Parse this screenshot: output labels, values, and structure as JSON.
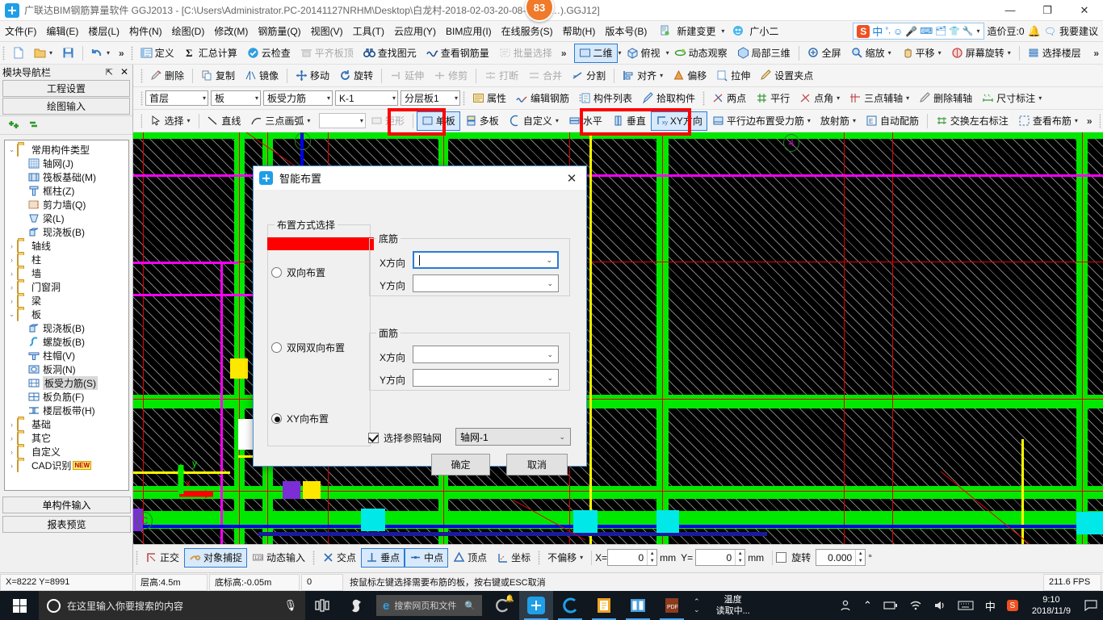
{
  "window": {
    "title": "广联达BIM钢筋算量软件 GGJ2013 - [C:\\Users\\Administrator.PC-20141127NRHM\\Desktop\\白龙村-2018-02-03-20-08-17(26…).GGJ12]",
    "badge": "83",
    "minimize": "—",
    "maximize": "❐",
    "close": "✕"
  },
  "menu": {
    "items": [
      {
        "label": "文件(F)"
      },
      {
        "label": "编辑(E)"
      },
      {
        "label": "楼层(L)"
      },
      {
        "label": "构件(N)"
      },
      {
        "label": "绘图(D)"
      },
      {
        "label": "修改(M)"
      },
      {
        "label": "钢筋量(Q)"
      },
      {
        "label": "视图(V)"
      },
      {
        "label": "工具(T)"
      },
      {
        "label": "云应用(Y)"
      },
      {
        "label": "BIM应用(I)"
      },
      {
        "label": "在线服务(S)"
      },
      {
        "label": "帮助(H)"
      },
      {
        "label": "版本号(B)"
      }
    ],
    "new_change": "新建变更",
    "assistant": "广小二",
    "ime_zh": "中",
    "coins_label": "造价豆:0",
    "suggestion": "我要建议"
  },
  "toolbar_row1": {
    "left_icons": [
      "new-file",
      "open-file",
      "save-file",
      "undo"
    ],
    "overflow": "»",
    "items": [
      {
        "label": "定义",
        "icon": "define-icon",
        "disabled": false
      },
      {
        "label": "汇总计算",
        "icon": "sigma-icon",
        "disabled": false
      },
      {
        "label": "云检查",
        "icon": "cloud-check-icon",
        "disabled": false
      },
      {
        "label": "平齐板顶",
        "icon": "align-slab-icon",
        "disabled": true
      },
      {
        "label": "查找图元",
        "icon": "binoculars-icon",
        "disabled": false
      },
      {
        "label": "查看钢筋量",
        "icon": "rebar-view-icon",
        "disabled": false
      },
      {
        "label": "批量选择",
        "icon": "batch-select-icon",
        "disabled": true
      }
    ],
    "view_items": [
      {
        "label": "二维",
        "icon": "2d-icon",
        "dropdown": true,
        "selected": true
      },
      {
        "label": "俯视",
        "icon": "top-view-icon",
        "dropdown": true
      },
      {
        "label": "动态观察",
        "icon": "orbit-icon"
      },
      {
        "label": "局部三维",
        "icon": "local-3d-icon"
      },
      {
        "label": "全屏",
        "icon": "fullscreen-icon"
      },
      {
        "label": "缩放",
        "icon": "zoom-icon",
        "dropdown": true
      },
      {
        "label": "平移",
        "icon": "pan-icon",
        "dropdown": true
      },
      {
        "label": "屏幕旋转",
        "icon": "screen-rotate-icon",
        "dropdown": true
      },
      {
        "label": "选择楼层",
        "icon": "select-floor-icon"
      }
    ]
  },
  "toolbar_row2": {
    "items": [
      {
        "label": "删除",
        "icon": "delete-icon"
      },
      {
        "label": "复制",
        "icon": "copy-icon"
      },
      {
        "label": "镜像",
        "icon": "mirror-icon"
      },
      {
        "label": "移动",
        "icon": "move-icon"
      },
      {
        "label": "旋转",
        "icon": "rotate-icon"
      },
      {
        "label": "延伸",
        "icon": "extend-icon",
        "disabled": true
      },
      {
        "label": "修剪",
        "icon": "trim-icon",
        "disabled": true
      },
      {
        "label": "打断",
        "icon": "break-icon",
        "disabled": true
      },
      {
        "label": "合并",
        "icon": "merge-icon",
        "disabled": true
      },
      {
        "label": "分割",
        "icon": "split-icon"
      },
      {
        "label": "对齐",
        "icon": "align-icon",
        "dropdown": true
      },
      {
        "label": "偏移",
        "icon": "offset-icon"
      },
      {
        "label": "拉伸",
        "icon": "stretch-icon"
      },
      {
        "label": "设置夹点",
        "icon": "set-grip-icon"
      }
    ]
  },
  "toolbar_row3": {
    "selectors": [
      {
        "name": "floor",
        "value": "首层"
      },
      {
        "name": "category",
        "value": "板"
      },
      {
        "name": "component-type",
        "value": "板受力筋"
      },
      {
        "name": "component-name",
        "value": "K-1"
      },
      {
        "name": "layer",
        "value": "分层板1"
      }
    ],
    "items": [
      {
        "label": "属性",
        "icon": "property-icon"
      },
      {
        "label": "编辑钢筋",
        "icon": "edit-rebar-icon"
      },
      {
        "label": "构件列表",
        "icon": "component-list-icon"
      },
      {
        "label": "拾取构件",
        "icon": "pick-component-icon"
      },
      {
        "label": "两点",
        "icon": "two-point-icon"
      },
      {
        "label": "平行",
        "icon": "parallel-icon"
      },
      {
        "label": "点角",
        "icon": "point-angle-icon",
        "dropdown": true
      },
      {
        "label": "三点辅轴",
        "icon": "three-point-axis-icon",
        "dropdown": true
      },
      {
        "label": "删除辅轴",
        "icon": "delete-axis-icon"
      },
      {
        "label": "尺寸标注",
        "icon": "dimension-icon",
        "dropdown": true
      }
    ]
  },
  "toolbar_row4": {
    "items": [
      {
        "label": "选择",
        "icon": "cursor-icon",
        "dropdown": true
      },
      {
        "label": "直线",
        "icon": "line-icon"
      },
      {
        "label": "三点画弧",
        "icon": "arc-icon",
        "dropdown": true
      },
      {
        "label": "矩形",
        "icon": "rect-icon",
        "disabled": true
      },
      {
        "label": "单板",
        "icon": "single-slab-icon",
        "selected": true,
        "highlight": true
      },
      {
        "label": "多板",
        "icon": "multi-slab-icon"
      },
      {
        "label": "自定义",
        "icon": "custom-icon",
        "dropdown": true
      },
      {
        "label": "水平",
        "icon": "horizontal-icon"
      },
      {
        "label": "垂直",
        "icon": "vertical-icon",
        "highlight": true
      },
      {
        "label": "XY方向",
        "icon": "xy-direction-icon",
        "selected": true,
        "highlight": true
      },
      {
        "label": "平行边布置受力筋",
        "icon": "parallel-edge-icon",
        "dropdown": true
      },
      {
        "label": "放射筋",
        "icon": "radial-rebar-icon",
        "dropdown": true
      },
      {
        "label": "自动配筋",
        "icon": "auto-rebar-icon"
      },
      {
        "label": "交换左右标注",
        "icon": "swap-label-icon"
      },
      {
        "label": "查看布筋",
        "icon": "view-rebar-icon",
        "dropdown": true
      }
    ],
    "empty_combo": ""
  },
  "sidebar": {
    "panel_title": "模块导航栏",
    "pin": "⇱",
    "close": "✕",
    "tabs": [
      {
        "label": "工程设置"
      },
      {
        "label": "绘图输入"
      }
    ],
    "tree": [
      {
        "label": "常用构件类型",
        "level": 0,
        "expanded": true,
        "icon": "folder-open-icon"
      },
      {
        "label": "轴网(J)",
        "level": 1,
        "icon": "grid-icon"
      },
      {
        "label": "筏板基础(M)",
        "level": 1,
        "icon": "raft-foundation-icon"
      },
      {
        "label": "框柱(Z)",
        "level": 1,
        "icon": "frame-column-icon"
      },
      {
        "label": "剪力墙(Q)",
        "level": 1,
        "icon": "shear-wall-icon"
      },
      {
        "label": "梁(L)",
        "level": 1,
        "icon": "beam-icon"
      },
      {
        "label": "现浇板(B)",
        "level": 1,
        "icon": "cast-slab-icon"
      },
      {
        "label": "轴线",
        "level": 0,
        "expanded": false,
        "icon": "folder-icon"
      },
      {
        "label": "柱",
        "level": 0,
        "expanded": false,
        "icon": "folder-icon"
      },
      {
        "label": "墙",
        "level": 0,
        "expanded": false,
        "icon": "folder-icon"
      },
      {
        "label": "门窗洞",
        "level": 0,
        "expanded": false,
        "icon": "folder-icon"
      },
      {
        "label": "梁",
        "level": 0,
        "expanded": false,
        "icon": "folder-icon"
      },
      {
        "label": "板",
        "level": 0,
        "expanded": true,
        "icon": "folder-open-icon"
      },
      {
        "label": "现浇板(B)",
        "level": 1,
        "icon": "cast-slab-icon"
      },
      {
        "label": "螺旋板(B)",
        "level": 1,
        "icon": "spiral-slab-icon"
      },
      {
        "label": "柱帽(V)",
        "level": 1,
        "icon": "column-cap-icon"
      },
      {
        "label": "板洞(N)",
        "level": 1,
        "icon": "slab-hole-icon"
      },
      {
        "label": "板受力筋(S)",
        "level": 1,
        "icon": "slab-rebar-icon",
        "selected": true
      },
      {
        "label": "板负筋(F)",
        "level": 1,
        "icon": "negative-rebar-icon"
      },
      {
        "label": "楼层板带(H)",
        "level": 1,
        "icon": "slab-band-icon"
      },
      {
        "label": "基础",
        "level": 0,
        "expanded": false,
        "icon": "folder-icon"
      },
      {
        "label": "其它",
        "level": 0,
        "expanded": false,
        "icon": "folder-icon"
      },
      {
        "label": "自定义",
        "level": 0,
        "expanded": false,
        "icon": "folder-icon"
      },
      {
        "label": "CAD识别",
        "level": 0,
        "expanded": false,
        "icon": "folder-icon",
        "badge": "NEW"
      }
    ],
    "bottom_tabs": [
      {
        "label": "单构件输入"
      },
      {
        "label": "报表预览"
      }
    ]
  },
  "dialog": {
    "title": "智能布置",
    "close": "✕",
    "layout_group": "布置方式选择",
    "options": [
      {
        "label": "双向布置",
        "selected": false
      },
      {
        "label": "双网双向布置",
        "selected": false
      },
      {
        "label": "XY向布置",
        "selected": true
      }
    ],
    "bottom_group": "底筋",
    "top_group": "面筋",
    "bottom_fields": [
      {
        "label": "X方向",
        "value": "",
        "focused": true
      },
      {
        "label": "Y方向",
        "value": "",
        "focused": false
      }
    ],
    "top_fields": [
      {
        "label": "X方向",
        "value": "",
        "focused": false
      },
      {
        "label": "Y方向",
        "value": "",
        "focused": false
      }
    ],
    "reference_checkbox": {
      "label": "选择参照轴网",
      "checked": true
    },
    "reference_value": "轴网-1",
    "ok": "确定",
    "cancel": "取消"
  },
  "snapbar": {
    "items": [
      {
        "label": "正交",
        "icon": "ortho-icon",
        "selected": false
      },
      {
        "label": "对象捕捉",
        "icon": "object-snap-icon",
        "selected": true
      },
      {
        "label": "动态输入",
        "icon": "dynamic-input-icon",
        "selected": false
      },
      {
        "label": "交点",
        "icon": "intersection-icon",
        "selected": false
      },
      {
        "label": "垂点",
        "icon": "perpendicular-icon",
        "selected": true
      },
      {
        "label": "中点",
        "icon": "midpoint-icon",
        "selected": true
      },
      {
        "label": "顶点",
        "icon": "vertex-icon",
        "selected": false
      },
      {
        "label": "坐标",
        "icon": "coordinate-icon",
        "selected": false
      }
    ],
    "offset_mode": "不偏移",
    "x_label": "X=",
    "x_value": "0",
    "x_unit": "mm",
    "y_label": "Y=",
    "y_value": "0",
    "y_unit": "mm",
    "rotate_label": "旋转",
    "rotate_value": "0.000",
    "rotate_unit": "°",
    "rotate_checked": false
  },
  "statusbar": {
    "coords": "X=8222  Y=8991",
    "floor_height": "层高:4.5m",
    "base_elevation": "底标高:-0.05m",
    "zero": "0",
    "hint": "按鼠标左键选择需要布筋的板，按右键或ESC取消",
    "fps": "211.6 FPS"
  },
  "canvas": {
    "axis_labels": [
      "4",
      "5",
      "C"
    ],
    "description": "CAD slab rebar layout view"
  },
  "taskbar": {
    "search_placeholder": "在这里输入你要搜索的内容",
    "edge_search": "搜索网页和文件",
    "temperature_label": "温度",
    "temperature_value": "读取中...",
    "ime": "中",
    "time": "9:10",
    "date": "2018/11/9",
    "icons": [
      {
        "name": "task-view-icon"
      },
      {
        "name": "app-s-icon"
      },
      {
        "name": "edge-icon"
      },
      {
        "name": "glodon-cloud-icon"
      },
      {
        "name": "ggj-app-icon"
      },
      {
        "name": "glodon-icon"
      },
      {
        "name": "notepad-icon"
      },
      {
        "name": "dictionary-icon"
      },
      {
        "name": "pdf-icon"
      }
    ]
  },
  "colors": {
    "accent": "#1e9fe8",
    "highlight_red": "#ff0000",
    "beam_green": "#00e800",
    "axis_red": "#e00000",
    "magenta": "#ff00ff",
    "yellow": "#ffff00",
    "blue": "#0000e8",
    "cyan": "#00e8e8",
    "taskbar_bg": "#10171e",
    "selected_blue": "#2b7cd3"
  }
}
